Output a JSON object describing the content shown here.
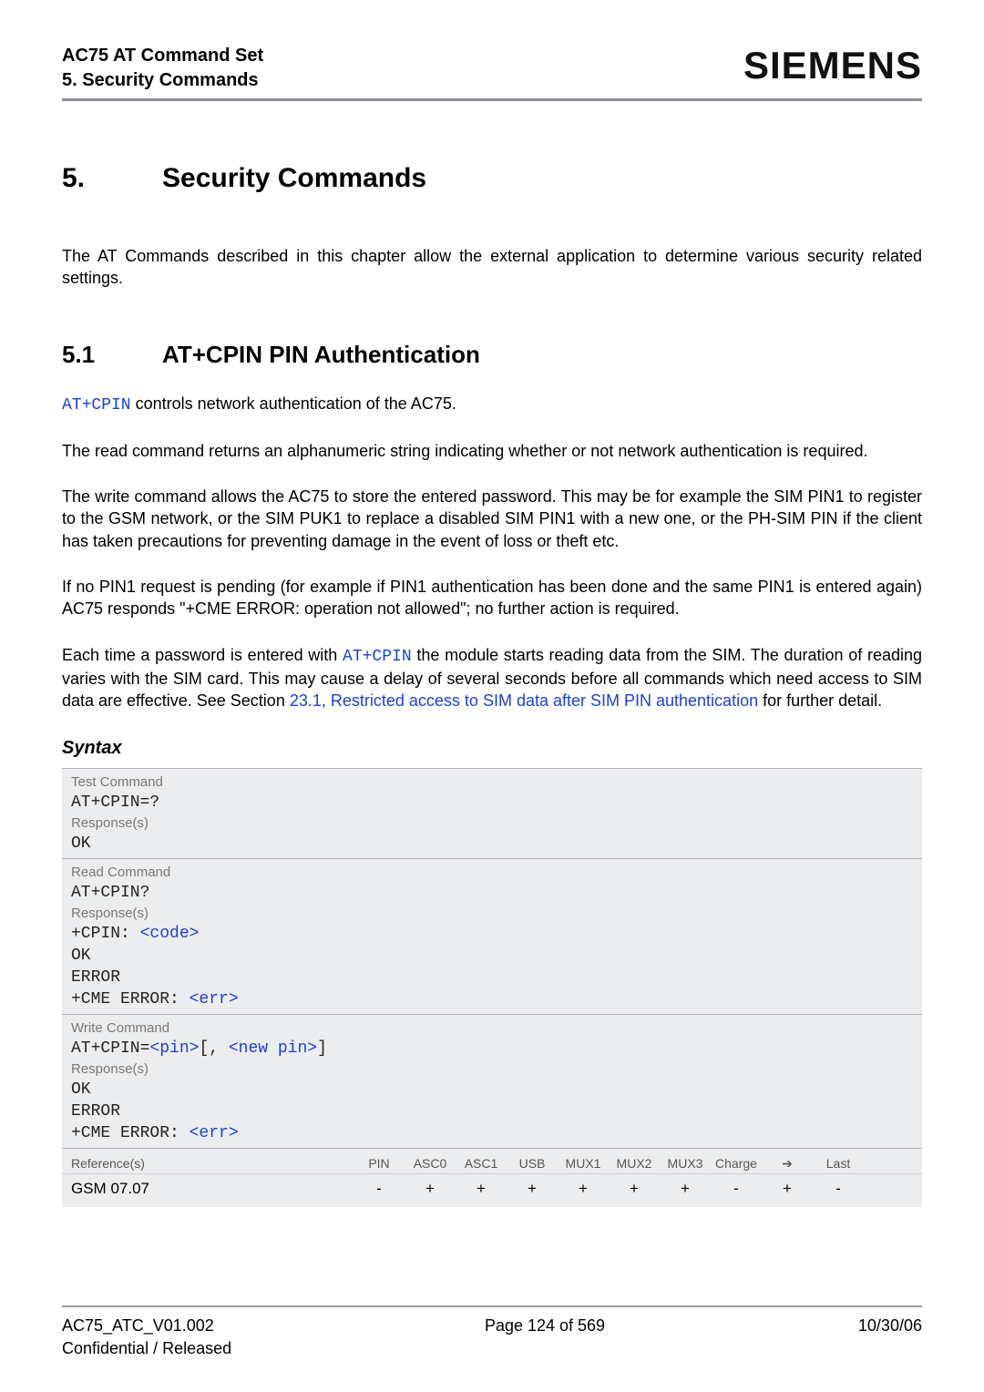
{
  "header": {
    "title_line1": "AC75 AT Command Set",
    "title_line2": "5. Security Commands",
    "brand": "SIEMENS"
  },
  "section": {
    "number": "5.",
    "title": "Security Commands",
    "intro": "The AT Commands described in this chapter allow the external application to determine various security related settings."
  },
  "subsection": {
    "number": "5.1",
    "title": "AT+CPIN   PIN Authentication",
    "p1_lead": "AT+CPIN",
    "p1_rest": " controls network authentication of the AC75.",
    "p2": "The read command returns an alphanumeric string indicating whether or not network authentication is required.",
    "p3": "The write command allows the AC75 to store the entered password. This may be for example the SIM PIN1 to register to the GSM network, or the SIM PUK1 to replace a disabled SIM PIN1 with a new one, or the PH-SIM PIN if the client has taken precautions for preventing damage in the event of loss or theft etc.",
    "p4": "If no PIN1 request is pending (for example if PIN1 authentication has been done and the same PIN1 is entered again) AC75 responds \"+CME ERROR: operation not allowed\"; no further action is required.",
    "p5_a": "Each time a password is entered with ",
    "p5_link": "AT+CPIN",
    "p5_b": " the module starts reading data from the SIM. The duration of reading varies with the SIM card. This may cause a delay of several seconds before all commands which need access to SIM data are effective. See Section ",
    "p5_doclink": "23.1, Restricted access to SIM data after SIM PIN authentication",
    "p5_c": " for further detail."
  },
  "syntax": {
    "heading": "Syntax",
    "test": {
      "label": "Test Command",
      "cmd": "AT+CPIN=?",
      "resp_label": "Response(s)",
      "lines": [
        "OK"
      ]
    },
    "read": {
      "label": "Read Command",
      "cmd": "AT+CPIN?",
      "resp_label": "Response(s)",
      "l1a": "+CPIN: ",
      "l1b": "<code>",
      "l2": "OK",
      "l3": "ERROR",
      "l4a": "+CME ERROR: ",
      "l4b": "<err>"
    },
    "write": {
      "label": "Write Command",
      "cmd_a": "AT+CPIN=",
      "cmd_b": "<pin>",
      "cmd_c": "[, ",
      "cmd_d": "<new pin>",
      "cmd_e": "]",
      "resp_label": "Response(s)",
      "l1": "OK",
      "l2": "ERROR",
      "l3a": "+CME ERROR: ",
      "l3b": "<err>"
    },
    "ref": {
      "label": "Reference(s)",
      "cols": [
        "PIN",
        "ASC0",
        "ASC1",
        "USB",
        "MUX1",
        "MUX2",
        "MUX3",
        "Charge",
        "➔",
        "Last"
      ],
      "name": "GSM 07.07",
      "vals": [
        "-",
        "+",
        "+",
        "+",
        "+",
        "+",
        "+",
        "-",
        "+",
        "-"
      ]
    }
  },
  "footer": {
    "left1": "AC75_ATC_V01.002",
    "left2": "Confidential / Released",
    "center": "Page 124 of 569",
    "right": "10/30/06"
  }
}
